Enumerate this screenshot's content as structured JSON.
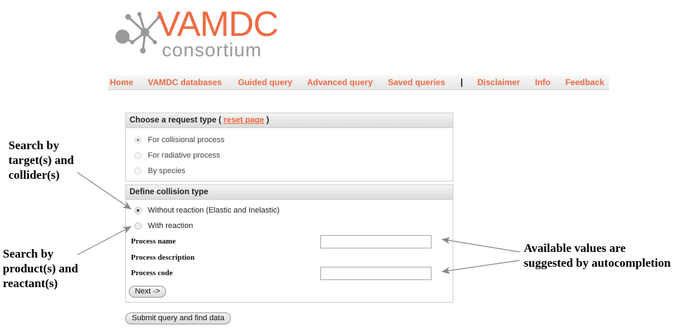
{
  "logo": {
    "word": "VAMDC",
    "sub": "consortium",
    "colors": {
      "accent": "#ec6b43",
      "node": "#999999"
    }
  },
  "nav": {
    "items": [
      "Home",
      "VAMDC databases",
      "Guided query",
      "Advanced query",
      "Saved queries",
      "Disclaimer",
      "Info",
      "Feedback"
    ],
    "separator": "|"
  },
  "request_panel": {
    "title_prefix": "Choose a request type (",
    "reset_link": "reset page",
    "title_suffix": ")",
    "options": [
      "For collisional process",
      "For radiative process",
      "By species"
    ],
    "selected": 0
  },
  "collision_panel": {
    "title": "Define collision type",
    "options": [
      "Without reaction (Elastic and Inelastic)",
      "With reaction"
    ],
    "selected": 0,
    "fields": {
      "process_name": {
        "label": "Process name",
        "value": ""
      },
      "process_description": {
        "label": "Process description"
      },
      "process_code": {
        "label": "Process code",
        "value": ""
      }
    },
    "next_button": "Next ->"
  },
  "submit_button": "Submit query and find data",
  "annotations": {
    "target_collider": [
      "Search by",
      "target(s) and",
      "collider(s)"
    ],
    "product_reactant": [
      "Search by",
      "product(s) and",
      "reactant(s)"
    ],
    "autocompletion": [
      "Available values are",
      "suggested by autocompletion"
    ]
  }
}
